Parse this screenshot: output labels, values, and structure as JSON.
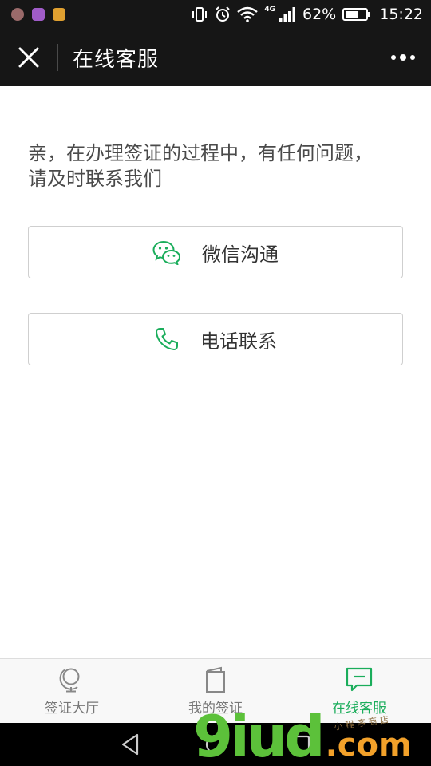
{
  "status_bar": {
    "network": "4G",
    "battery": "62%",
    "battery_level": 0.62,
    "time": "15:22",
    "app_icon_colors": [
      "#9a6a6a",
      "#a05cc8",
      "#e0a030"
    ]
  },
  "title_bar": {
    "title": "在线客服"
  },
  "content": {
    "intro_line1": "亲，在办理签证的过程中，有任何问题，",
    "intro_line2": "请及时联系我们",
    "wechat_label": "微信沟通",
    "phone_label": "电话联系"
  },
  "tab_bar": {
    "tabs": [
      {
        "label": "签证大厅",
        "icon": "globe-icon",
        "active": false
      },
      {
        "label": "我的签证",
        "icon": "passport-icon",
        "active": false
      },
      {
        "label": "在线客服",
        "icon": "chat-icon",
        "active": true
      }
    ]
  },
  "watermark": {
    "digits": "9iud",
    "suffix": ".com",
    "small": "小 程 序 商 店"
  },
  "colors": {
    "accent": "#1aad5b",
    "header_bg": "#161616"
  }
}
